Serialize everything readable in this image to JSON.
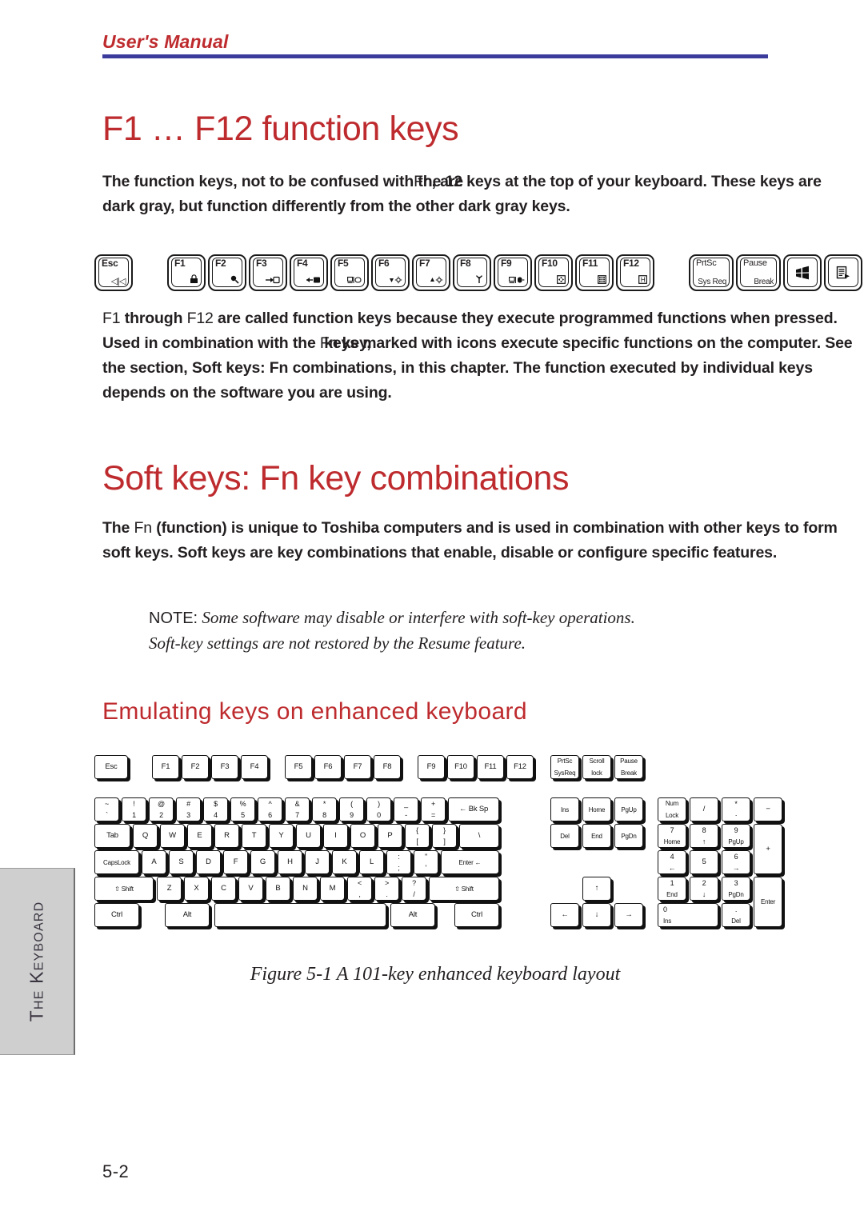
{
  "running_head": {
    "text": "User's Manual",
    "rule_color": "#3b3b9c",
    "text_color": "#be2b2e"
  },
  "headings": {
    "h1_function_keys": "F1 … F12 function keys",
    "h1_soft_keys": "Soft keys: Fn key combinations",
    "h2_emulating": "Emulating keys on enhanced keyboard"
  },
  "paragraphs": {
    "p1": {
      "before": "The function keys, not to be confused with",
      "overlap_light": "Fn",
      "overlap_bold": ", are",
      "after": " the 12 keys at the top of your keyboard. These keys are dark gray, but function differently from the other dark gray keys."
    },
    "p2": {
      "seg1_light": "F1",
      "seg2": " through ",
      "seg3_light": "F12",
      "seg4": " are called function keys because they execute programmed functions when pressed. Used in combination with the ",
      "overlap_light": "Fn",
      "overlap_bold": " key,",
      "seg5": " keys marked with icons execute specific functions on the computer. See the section, Soft keys: Fn combinations, in this chapter. The function executed by individual keys depends on the software you are using."
    },
    "p3": {
      "seg1": "The ",
      "seg2_light": "Fn",
      "seg3": " (function) is unique to Toshiba computers and is used in combination with other keys to form soft keys. Soft keys are key combinations that enable, disable or configure specific features."
    }
  },
  "note": {
    "label": "NOTE:",
    "line1": "Some software may disable or interfere with soft-key operations.",
    "line2": "Soft-key settings are not restored by the Resume feature."
  },
  "figure_caption": "Figure 5-1 A 101-key enhanced keyboard layout",
  "page_number": "5-2",
  "side_tab": {
    "label": "The Keyboard"
  },
  "fnkey_strip": {
    "keys": [
      {
        "name": "esc",
        "top": "Esc",
        "icon": "◁|◁",
        "bold": true
      },
      {
        "gap": "large"
      },
      {
        "name": "f1",
        "top": "F1",
        "icon": "🔒"
      },
      {
        "name": "f2",
        "top": "F2",
        "icon": "🔍"
      },
      {
        "name": "f3",
        "top": "F3",
        "icon": "→▭"
      },
      {
        "name": "f4",
        "top": "F4",
        "icon": "←▰"
      },
      {
        "name": "f5",
        "top": "F5",
        "icon": "▤/▢"
      },
      {
        "name": "f6",
        "top": "F6",
        "icon": "▼☼"
      },
      {
        "name": "f7",
        "top": "F7",
        "icon": "▲☼"
      },
      {
        "name": "f8",
        "top": "F8",
        "icon": "ᛉ"
      },
      {
        "name": "f9",
        "top": "F9",
        "icon": "▭/☏"
      },
      {
        "name": "f10",
        "top": "F10",
        "icon": "⊞"
      },
      {
        "name": "f11",
        "top": "F11",
        "icon": "▦"
      },
      {
        "name": "f12",
        "top": "F12",
        "icon": "⊞"
      },
      {
        "gap": "large"
      },
      {
        "name": "prtsc",
        "top": "PrtSc",
        "bottom": "Sys Req",
        "wide": true
      },
      {
        "name": "pause",
        "top": "Pause",
        "bottom": "Break",
        "wide": true
      },
      {
        "name": "windows",
        "center": "⊞"
      },
      {
        "name": "menu",
        "center": "▤"
      }
    ]
  },
  "keyboard": {
    "fn_row": [
      {
        "label": "Esc"
      },
      {
        "label": "F1"
      },
      {
        "label": "F2"
      },
      {
        "label": "F3"
      },
      {
        "label": "F4"
      },
      {
        "label": "F5"
      },
      {
        "label": "F6"
      },
      {
        "label": "F7"
      },
      {
        "label": "F8"
      },
      {
        "label": "F9"
      },
      {
        "label": "F10"
      },
      {
        "label": "F11"
      },
      {
        "label": "F12"
      },
      {
        "upper": "PrtSc",
        "lower": "SysReq"
      },
      {
        "upper": "Scroll",
        "lower": "lock"
      },
      {
        "upper": "Pause",
        "lower": "Break"
      }
    ],
    "num_row": [
      {
        "upper": "~",
        "lower": "`"
      },
      {
        "upper": "!",
        "lower": "1"
      },
      {
        "upper": "@",
        "lower": "2"
      },
      {
        "upper": "#",
        "lower": "3"
      },
      {
        "upper": "$",
        "lower": "4"
      },
      {
        "upper": "%",
        "lower": "5"
      },
      {
        "upper": "^",
        "lower": "6"
      },
      {
        "upper": "&",
        "lower": "7"
      },
      {
        "upper": "*",
        "lower": "8"
      },
      {
        "upper": "(",
        "lower": "9"
      },
      {
        "upper": ")",
        "lower": "0"
      },
      {
        "upper": "_",
        "lower": "-"
      },
      {
        "upper": "+",
        "lower": "="
      },
      {
        "label": "←    Bk Sp"
      }
    ],
    "qwerty_row": [
      {
        "label": "Tab"
      },
      {
        "label": "Q"
      },
      {
        "label": "W"
      },
      {
        "label": "E"
      },
      {
        "label": "R"
      },
      {
        "label": "T"
      },
      {
        "label": "Y"
      },
      {
        "label": "U"
      },
      {
        "label": "I"
      },
      {
        "label": "O"
      },
      {
        "label": "P"
      },
      {
        "upper": "{",
        "lower": "["
      },
      {
        "upper": "}",
        "lower": "]"
      },
      {
        "label": "\\"
      }
    ],
    "asdf_row": [
      {
        "label": "CapsLock"
      },
      {
        "label": "A"
      },
      {
        "label": "S"
      },
      {
        "label": "D"
      },
      {
        "label": "F"
      },
      {
        "label": "G"
      },
      {
        "label": "H"
      },
      {
        "label": "J"
      },
      {
        "label": "K"
      },
      {
        "label": "L"
      },
      {
        "upper": ":",
        "lower": ";"
      },
      {
        "upper": "\"",
        "lower": "'"
      },
      {
        "label": "Enter  ←"
      }
    ],
    "zxcv_row": [
      {
        "label": "⇧ Shift"
      },
      {
        "label": "Z"
      },
      {
        "label": "X"
      },
      {
        "label": "C"
      },
      {
        "label": "V"
      },
      {
        "label": "B"
      },
      {
        "label": "N"
      },
      {
        "label": "M"
      },
      {
        "upper": "<",
        "lower": ","
      },
      {
        "upper": ">",
        "lower": "."
      },
      {
        "upper": "?",
        "lower": "/"
      },
      {
        "label": "⇧ Shift"
      }
    ],
    "bottom_row": [
      {
        "label": "Ctrl"
      },
      {
        "label": "Alt"
      },
      {
        "label": ""
      },
      {
        "label": "Alt"
      },
      {
        "label": "Ctrl"
      }
    ],
    "nav_cluster": [
      {
        "label": "Ins"
      },
      {
        "label": "Home"
      },
      {
        "label": "PgUp"
      },
      {
        "label": "Del"
      },
      {
        "label": "End"
      },
      {
        "label": "PgDn"
      }
    ],
    "arrows": [
      {
        "label": "↑"
      },
      {
        "label": "←"
      },
      {
        "label": "↓"
      },
      {
        "label": "→"
      }
    ],
    "numpad": [
      {
        "upper": "Num",
        "lower": "Lock"
      },
      {
        "label": "/"
      },
      {
        "upper": "*",
        "lower": "·"
      },
      {
        "label": "−"
      },
      {
        "upper": "7",
        "lower": "Home"
      },
      {
        "upper": "8",
        "lower": "↑"
      },
      {
        "upper": "9",
        "lower": "PgUp"
      },
      {
        "label": "+"
      },
      {
        "upper": "4",
        "lower": "←"
      },
      {
        "label": "5"
      },
      {
        "upper": "6",
        "lower": "→"
      },
      {
        "upper": "1",
        "lower": "End"
      },
      {
        "upper": "2",
        "lower": "↓"
      },
      {
        "upper": "3",
        "lower": "PgDn"
      },
      {
        "label": "Enter"
      },
      {
        "upper": "0",
        "lower": "Ins"
      },
      {
        "upper": ".",
        "lower": "Del"
      }
    ]
  }
}
